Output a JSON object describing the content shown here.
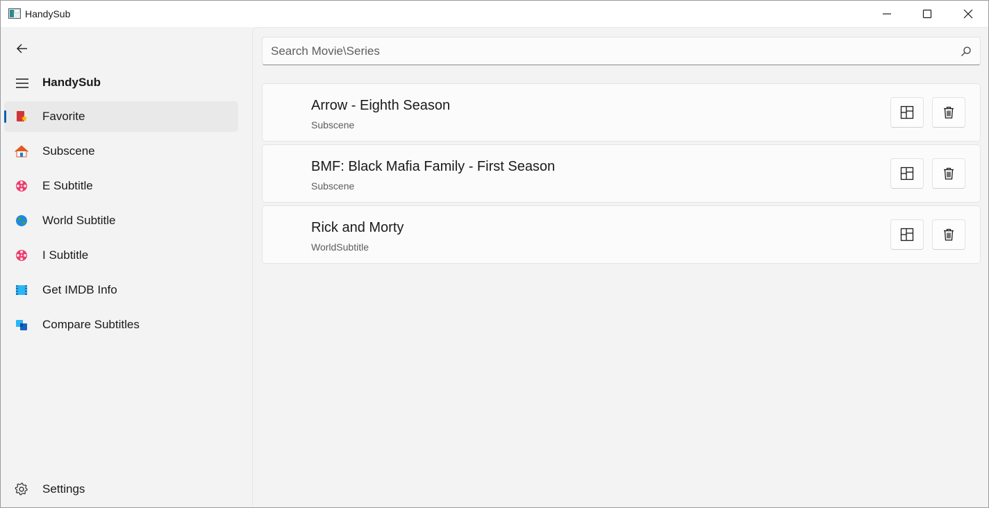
{
  "window": {
    "title": "HandySub"
  },
  "sidebar": {
    "app_name": "HandySub",
    "items": [
      {
        "label": "Favorite",
        "icon": "favorite-bookmark-icon",
        "selected": true
      },
      {
        "label": "Subscene",
        "icon": "house-icon",
        "selected": false
      },
      {
        "label": "E Subtitle",
        "icon": "film-reel-icon",
        "selected": false
      },
      {
        "label": "World Subtitle",
        "icon": "globe-icon",
        "selected": false
      },
      {
        "label": "I Subtitle",
        "icon": "film-reel-icon",
        "selected": false
      },
      {
        "label": "Get IMDB Info",
        "icon": "film-strip-icon",
        "selected": false
      },
      {
        "label": "Compare Subtitles",
        "icon": "compare-icon",
        "selected": false
      }
    ],
    "settings_label": "Settings"
  },
  "search": {
    "placeholder": "Search Movie\\Series",
    "value": ""
  },
  "favorites": [
    {
      "title": "Arrow - Eighth Season",
      "source": "Subscene"
    },
    {
      "title": "BMF: Black Mafia Family - First Season",
      "source": "Subscene"
    },
    {
      "title": "Rick and Morty",
      "source": "WorldSubtitle"
    }
  ],
  "colors": {
    "accent": "#005fb8",
    "background": "#f3f3f3",
    "card": "#fbfbfb"
  }
}
